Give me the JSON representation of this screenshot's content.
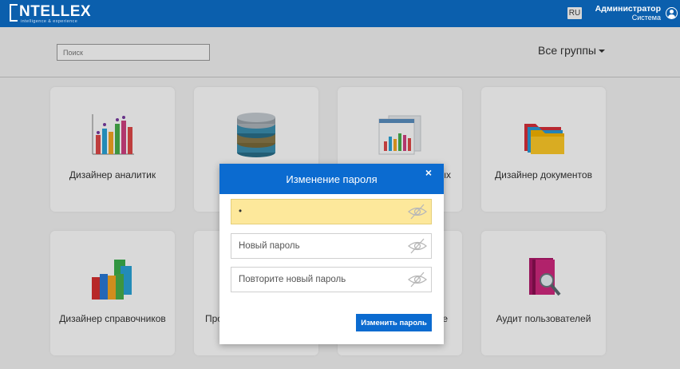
{
  "header": {
    "logo_text": "NTELLEX",
    "logo_tagline": "intelligence & experience",
    "language": "RU",
    "user_name": "Администратор",
    "user_role": "Система"
  },
  "search": {
    "placeholder": "Поиск"
  },
  "groups": {
    "label": "Все группы"
  },
  "tiles": [
    {
      "label": "Дизайнер аналитик",
      "icon": "bar-chart-icon"
    },
    {
      "label": "",
      "icon": "database-icon"
    },
    {
      "label": "",
      "icon": "report-chart-icon"
    },
    {
      "label": "Дизайнер документов",
      "icon": "folders-icon"
    },
    {
      "label": "Дизайнер справочников",
      "icon": "books-icon"
    },
    {
      "label": "Про",
      "icon": ""
    },
    {
      "label": "",
      "icon": ""
    },
    {
      "label": "Аудит пользователей",
      "icon": "audit-book-icon"
    }
  ],
  "tile_partial_texts": {
    "tile3_right": "ых",
    "tile7_right": "е"
  },
  "modal": {
    "title": "Изменение пароля",
    "close_label": "×",
    "current_password_value": "•",
    "new_password_placeholder": "Новый пароль",
    "repeat_password_placeholder": "Повторите новый пароль",
    "submit_label": "Изменить пароль"
  },
  "colors": {
    "header": "#0b5fad",
    "accent": "#0b6bd0",
    "autofill": "#fde89b"
  }
}
